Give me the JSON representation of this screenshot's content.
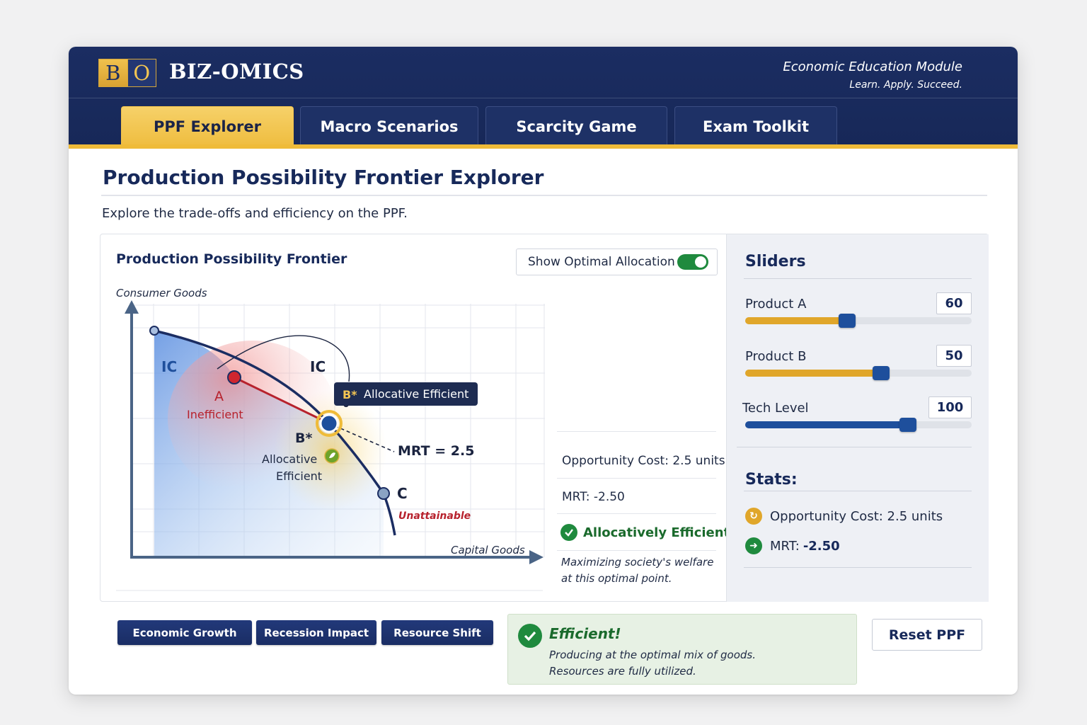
{
  "header": {
    "logo_left": "B",
    "logo_right": "O",
    "brand": "BIZ-OMICS",
    "module_title": "Economic Education Module",
    "module_tagline": "Learn. Apply. Succeed."
  },
  "tabs": [
    {
      "label": "PPF Explorer",
      "active": true
    },
    {
      "label": "Macro Scenarios",
      "active": false
    },
    {
      "label": "Scarcity Game",
      "active": false
    },
    {
      "label": "Exam Toolkit",
      "active": false
    }
  ],
  "page": {
    "title": "Production Possibility Frontier Explorer",
    "subtitle": "Explore the trade-offs and efficiency on the PPF."
  },
  "chart": {
    "title": "Production Possibility Frontier",
    "toggle_label": "Show Optimal Allocation",
    "toggle_on": true,
    "y_axis_label": "Consumer Goods",
    "x_axis_label": "Capital Goods",
    "ic_label_left": "IC",
    "ic_label_top": "IC",
    "point_a_label": "A",
    "point_a_desc": "Inefficient",
    "point_b_label": "B*",
    "point_b_desc_1": "Allocative",
    "point_b_desc_2": "Efficient",
    "point_c_label": "C",
    "point_c_desc": "Unattainable",
    "tooltip_label": "B*",
    "tooltip_text": "Allocative Efficient",
    "mrt_label": "MRT = 2.5",
    "colors": {
      "frontier": "#1b2d62",
      "point_a": "#c7262f",
      "point_b": "#1e4f9c",
      "highlight": "#efbb38"
    }
  },
  "info": {
    "opportunity_cost": "Opportunity Cost: 2.5 units",
    "mrt": "MRT: -2.50",
    "efficient_label": "Allocatively Efficient",
    "note_line1": "Maximizing society's welfare",
    "note_line2": "at this optimal point."
  },
  "sliders": {
    "heading": "Sliders",
    "items": [
      {
        "label": "Product A",
        "value": "60",
        "level": 0.45,
        "color": "#e0a62a"
      },
      {
        "label": "Product B",
        "value": "50",
        "level": 0.6,
        "color": "#e0a62a"
      },
      {
        "label": "Tech Level",
        "value": "100",
        "level": 0.72,
        "color": "#1e4f9c"
      }
    ]
  },
  "stats": {
    "heading": "Stats:",
    "opportunity_cost": "Opportunity Cost: 2.5 units",
    "mrt_label": "MRT: ",
    "mrt_value": "-2.50"
  },
  "actions": {
    "economic_growth": "Economic Growth",
    "recession_impact": "Recession Impact",
    "resource_shift": "Resource Shift",
    "reset": "Reset PPF"
  },
  "status": {
    "title": "Efficient!",
    "line1": "Producing at the optimal mix of goods.",
    "line2": "Resources are fully utilized."
  }
}
